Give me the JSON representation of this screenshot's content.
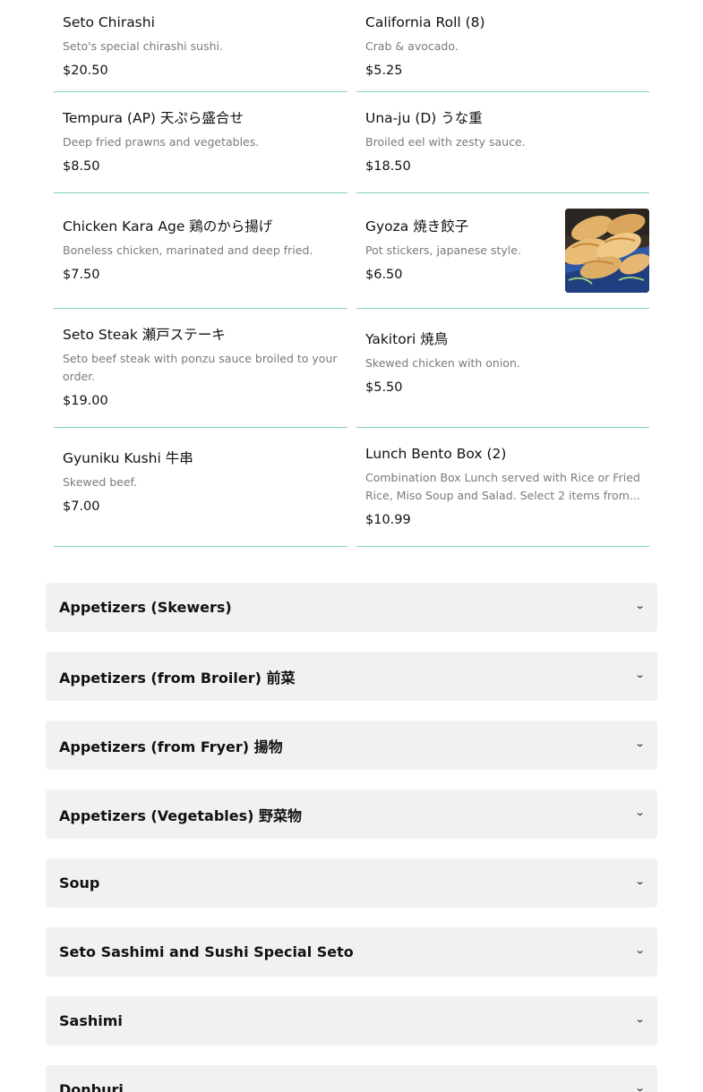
{
  "menu_items": [
    {
      "name": "Seto Chirashi",
      "desc": "Seto's special chirashi sushi.",
      "price": "$20.50"
    },
    {
      "name": "California Roll (8)",
      "desc": "Crab & avocado.",
      "price": "$5.25"
    },
    {
      "name": "Tempura (AP) 天ぷら盛合せ",
      "desc": "Deep fried prawns and vegetables.",
      "price": "$8.50"
    },
    {
      "name": "Una-ju (D) うな重",
      "desc": "Broiled eel with zesty sauce.",
      "price": "$18.50"
    },
    {
      "name": "Chicken Kara Age 鶏のから揚げ",
      "desc": "Boneless chicken, marinated and deep fried.",
      "price": "$7.50"
    },
    {
      "name": "Gyoza 焼き餃子",
      "desc": "Pot stickers, japanese style.",
      "price": "$6.50",
      "image": "gyoza-photo"
    },
    {
      "name": "Seto Steak 瀬戸ステーキ",
      "desc": "Seto beef steak with ponzu sauce broiled to your order.",
      "price": "$19.00"
    },
    {
      "name": "Yakitori 焼鳥",
      "desc": "Skewed chicken with onion.",
      "price": "$5.50"
    },
    {
      "name": "Gyuniku Kushi 牛串",
      "desc": "Skewed beef.",
      "price": "$7.00"
    },
    {
      "name": "Lunch Bento Box (2)",
      "desc": "Combination Box Lunch served with Rice or Fried Rice, Miso Soup and Salad. Select 2 items from...",
      "price": "$10.99"
    }
  ],
  "categories": [
    {
      "title": "Appetizers (Skewers)"
    },
    {
      "title": "Appetizers (from Broiler) 前菜"
    },
    {
      "title": "Appetizers (from Fryer) 揚物"
    },
    {
      "title": "Appetizers (Vegetables) 野菜物"
    },
    {
      "title": "Soup"
    },
    {
      "title": "Seto Sashimi and Sushi Special Seto"
    },
    {
      "title": "Sashimi"
    },
    {
      "title": "Donburi"
    }
  ],
  "colors": {
    "divider": "#7fcfbe",
    "category_bg": "#f1f1f1",
    "desc_text": "#7a7a7a"
  },
  "icons": {
    "chevron": "chevron-down-icon"
  }
}
